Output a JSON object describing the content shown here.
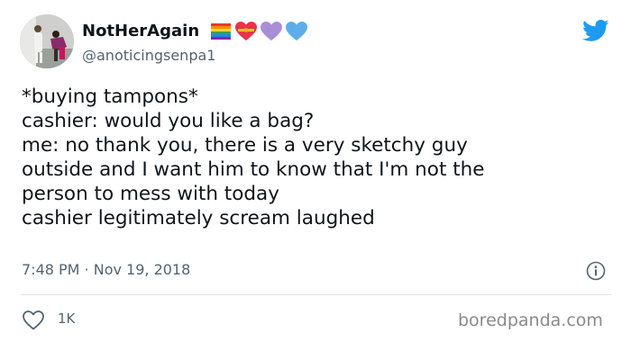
{
  "author": {
    "display_name": "NotHerAgain",
    "handle": "@anoticingsenpa1",
    "name_emojis": [
      "rainbow-flag",
      "heart-with-ribbon",
      "purple-heart",
      "blue-heart"
    ]
  },
  "tweet": {
    "lines": [
      "*buying tampons*",
      "cashier: would you like a bag?",
      "me: no thank you, there is a very sketchy guy",
      "outside and I want him to know that I'm not the",
      "person to mess with today",
      "cashier legitimately scream laughed"
    ],
    "timestamp": "7:48 PM · Nov 19, 2018",
    "like_count": "1K"
  },
  "icons": {
    "brand": "twitter-bird-icon",
    "info": "info-icon",
    "like": "heart-outline-icon"
  },
  "colors": {
    "twitter_blue": "#1d9bf0",
    "muted_text": "#536471",
    "divider": "#dfe3e6"
  },
  "watermark": "boredpanda.com"
}
